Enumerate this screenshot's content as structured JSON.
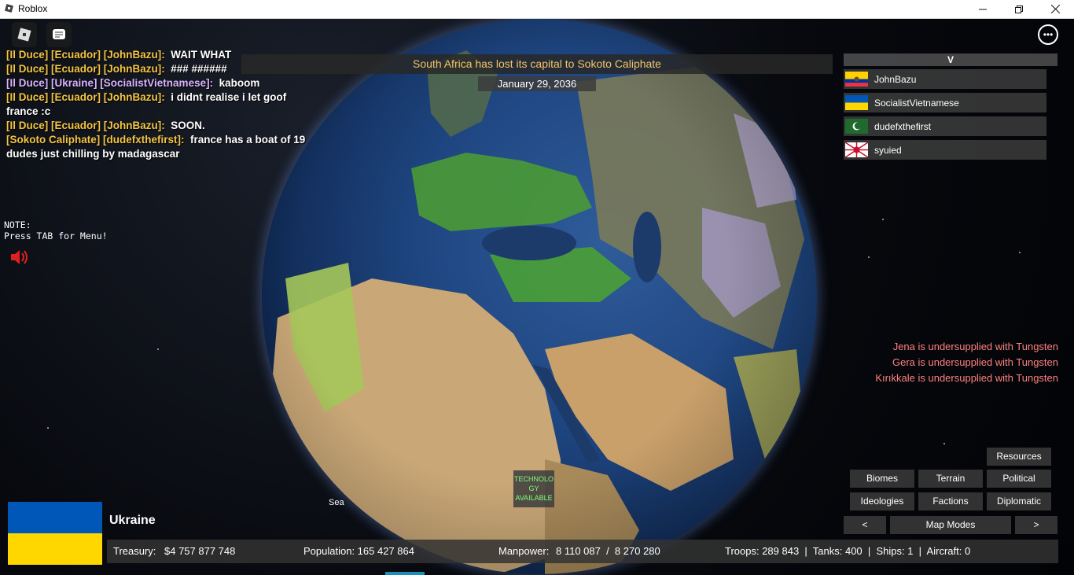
{
  "window": {
    "title": "Roblox"
  },
  "chat": {
    "lines": [
      {
        "tag": "[Il Duce] [Ecuador] [JohnBazu]:",
        "text": "WAIT WHAT"
      },
      {
        "tag": "[Il Duce] [Ecuador] [JohnBazu]:",
        "text": "### ######"
      },
      {
        "tag": "[Il Duce] [Ukraine] [SocialistVietnamese]:",
        "text": "kaboom"
      },
      {
        "tag": "[Il Duce] [Ecuador] [JohnBazu]:",
        "text": "i didnt realise i let goof france :c"
      },
      {
        "tag": "[Il Duce] [Ecuador] [JohnBazu]:",
        "text": "SOON."
      },
      {
        "tag": "[Sokoto Caliphate] [dudefxthefirst]:",
        "text": "france has a boat of 19 dudes just chilling by madagascar"
      }
    ]
  },
  "notice": "South Africa has lost its capital to Sokoto Caliphate",
  "date": "January 29, 2036",
  "note": "NOTE:\nPress TAB for Menu!",
  "players": {
    "header": "V",
    "list": [
      {
        "name": "JohnBazu",
        "flag": "ecuador"
      },
      {
        "name": "SocialistVietnamese",
        "flag": "ukraine"
      },
      {
        "name": "dudefxthefirst",
        "flag": "green-crescent"
      },
      {
        "name": "syuied",
        "flag": "rising-sun"
      }
    ]
  },
  "warnings": [
    "Jena is undersupplied with Tungsten",
    "Gera is undersupplied with Tungsten",
    "Kırıkkale is undersupplied with Tungsten"
  ],
  "map_modes": {
    "resources": "Resources",
    "biomes": "Biomes",
    "terrain": "Terrain",
    "political": "Political",
    "ideologies": "Ideologies",
    "factions": "Factions",
    "diplomatic": "Diplomatic",
    "prev": "<",
    "label": "Map Modes",
    "next": ">"
  },
  "tech": "TECHNOLO GY AVAILABLE",
  "sea_label": "Sea",
  "country": {
    "name": "Ukraine"
  },
  "stats": {
    "treasury_label": "Treasury:",
    "treasury": "$4 757 877 748",
    "population": "Population: 165 427 864",
    "manpower_label": "Manpower:",
    "manpower": "8 110 087  /  8 270 280",
    "military": "Troops: 289 843  |  Tanks: 400  |  Ships: 1  |  Aircraft: 0"
  },
  "colors": {
    "notice_text": "#f3c46a",
    "warning_text": "#ff8080",
    "chat_tag": "#f4c542",
    "tech_text": "#7dff7d"
  }
}
